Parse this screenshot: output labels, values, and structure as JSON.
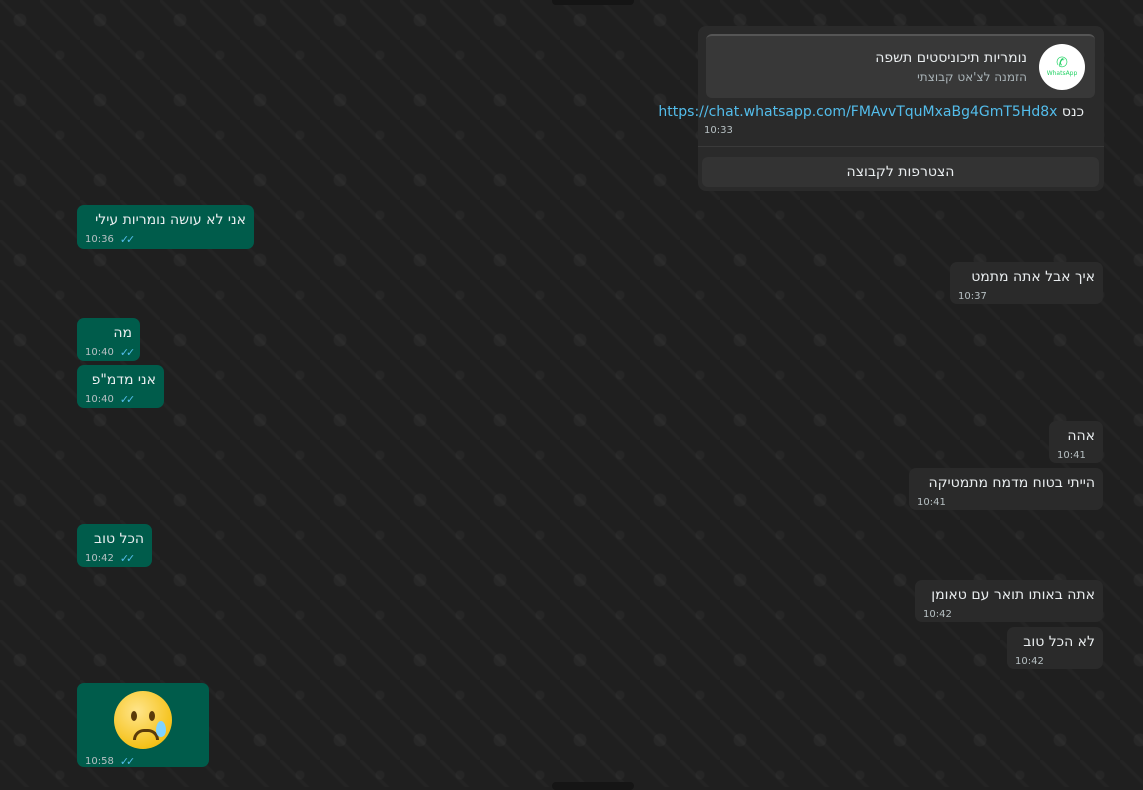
{
  "invite": {
    "group_name": "נומריות תיכוניסטים תשפה",
    "subtitle": "הזמנה לצ'אט קבוצתי",
    "link": "https://chat.whatsapp.com/FMAvvTquMxaBg4GmT5Hd8x",
    "prefix": "כנס",
    "time": "10:33",
    "join_label": "הצטרפות לקבוצה",
    "logo_text": "WhatsApp"
  },
  "messages": [
    {
      "dir": "out",
      "text": "אני לא עושה נומריות עילי",
      "time": "10:36"
    },
    {
      "dir": "in",
      "text": "איך אבל אתה  מתמט",
      "time": "10:37"
    },
    {
      "dir": "out",
      "text": "מה",
      "time": "10:40"
    },
    {
      "dir": "out",
      "text": "אני מדמ\"פ",
      "time": "10:40"
    },
    {
      "dir": "in",
      "text": "אהה",
      "time": "10:41"
    },
    {
      "dir": "in",
      "text": "הייתי בטוח מדמח מתמטיקה",
      "time": "10:41"
    },
    {
      "dir": "out",
      "text": "הכל טוב",
      "time": "10:42"
    },
    {
      "dir": "in",
      "text": "אתה באותו תואר עם טאומן",
      "time": "10:42"
    },
    {
      "dir": "in",
      "text": "לא הכל טוב",
      "time": "10:42"
    },
    {
      "dir": "out",
      "text": "",
      "emoji": "crying-face",
      "time": "10:58"
    }
  ],
  "colors": {
    "background": "#1f1f1f",
    "incoming_bubble": "#2a2a2a",
    "outgoing_bubble": "#005c4b",
    "link": "#53bdeb",
    "read_ticks": "#53bdeb"
  }
}
